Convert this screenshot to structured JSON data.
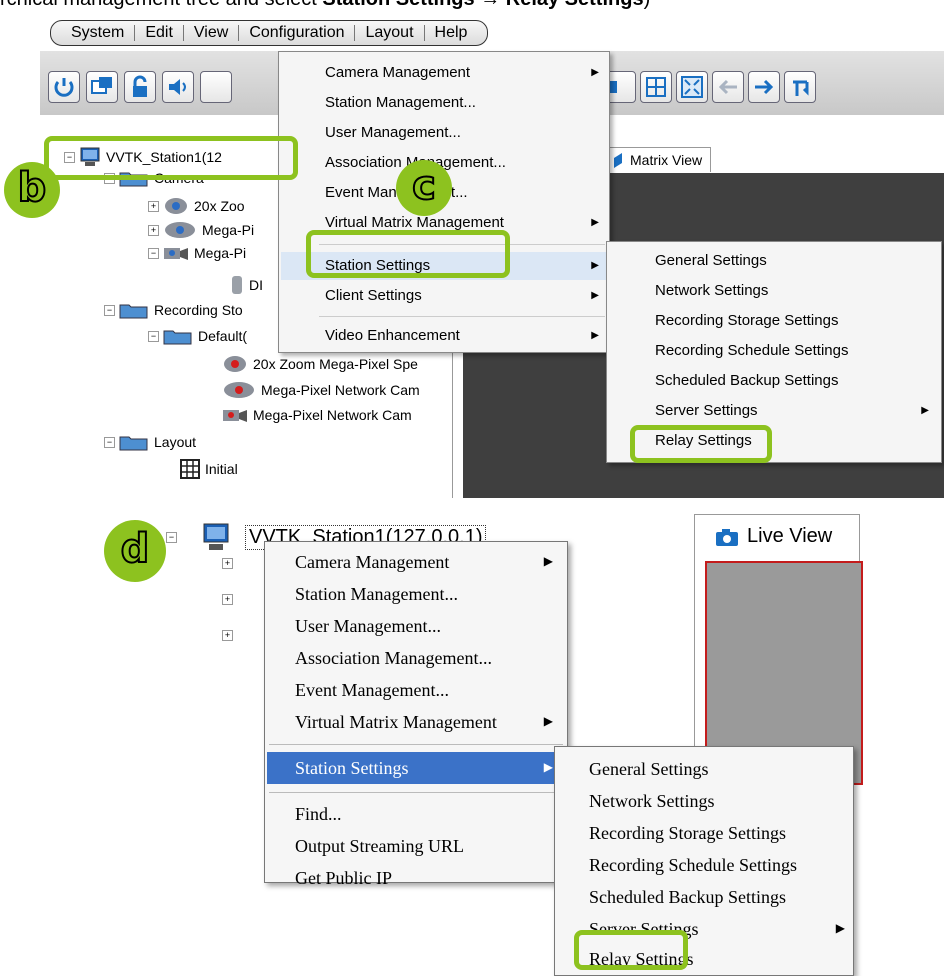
{
  "caption": {
    "text": "rchical management tree and select ",
    "bold": "Station Settings → Relay Settings",
    "suffix": ")"
  },
  "menubar": [
    "System",
    "Edit",
    "View",
    "Configuration",
    "Layout",
    "Help"
  ],
  "tree": {
    "station": "VVTK_Station1(12",
    "camera": "Camera",
    "cam1": "20x Zoo",
    "cam2": "Mega-Pi",
    "cam3": "Mega-Pi",
    "di": "DI",
    "recording": "Recording Sto",
    "default_group": "Default(",
    "rec_cam1": "20x Zoom Mega-Pixel Spe",
    "rec_cam2": "Mega-Pixel Network Cam",
    "rec_cam3": "Mega-Pixel Network Cam",
    "layout": "Layout",
    "initial": "Initial"
  },
  "tab": {
    "matrix_view": "Matrix View"
  },
  "config_menu": [
    "Camera Management",
    "Station Management...",
    "User Management...",
    "Association Management...",
    "Event Management...",
    "Virtual Matrix Management",
    "Station Settings",
    "Client Settings",
    "Video Enhancement"
  ],
  "station_submenu": [
    "General Settings",
    "Network Settings",
    "Recording Storage Settings",
    "Recording Schedule Settings",
    "Scheduled Backup Settings",
    "Server Settings",
    "Relay Settings"
  ],
  "badges": {
    "b": "b",
    "c": "c",
    "d": "d"
  },
  "bottom": {
    "station": "VVTK_Station1(127.0.0.1)",
    "live_view": "Live View",
    "context_menu": [
      "Camera Management",
      "Station Management...",
      "User Management...",
      "Association Management...",
      "Event Management...",
      "Virtual Matrix Management",
      "Station Settings",
      "Find...",
      "Output Streaming URL",
      "Get Public IP"
    ],
    "submenu": [
      "General Settings",
      "Network Settings",
      "Recording Storage Settings",
      "Recording Schedule Settings",
      "Scheduled Backup Settings",
      "Server Settings",
      "Relay Settings"
    ]
  },
  "colors": {
    "highlight_green": "#8dc21f",
    "menu_select_blue": "#3b72c8"
  }
}
